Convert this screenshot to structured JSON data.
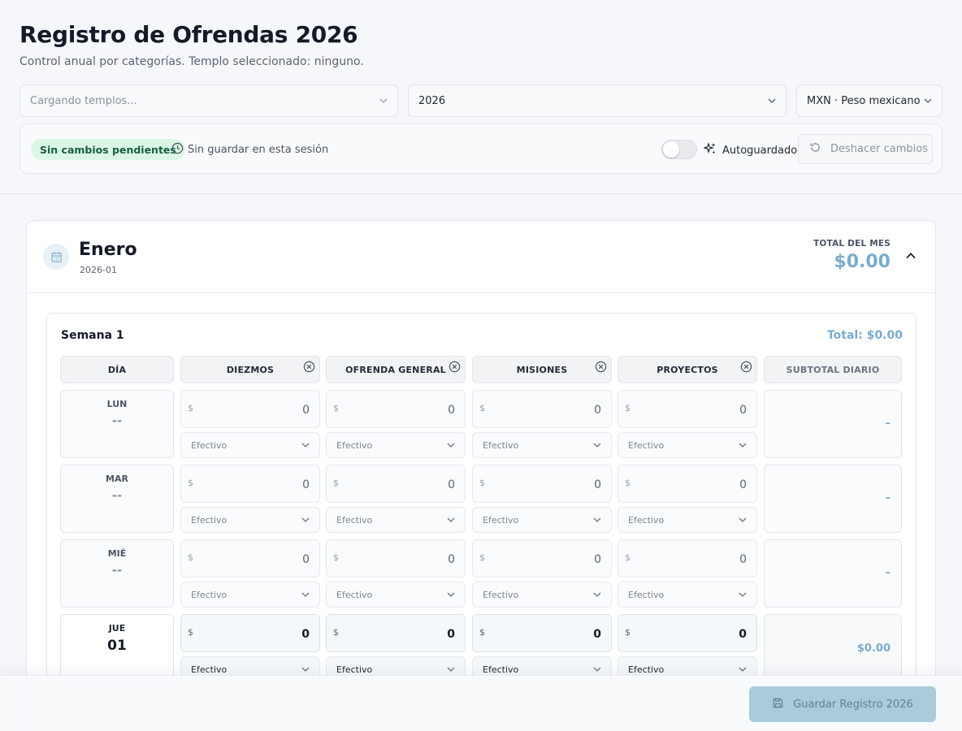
{
  "header": {
    "title": "Registro de Ofrendas 2026",
    "subtitle": "Control anual por categorías. Templo seleccionado: ninguno."
  },
  "filters": {
    "temple_placeholder": "Cargando templos...",
    "year": "2026",
    "currency": "MXN · Peso mexicano"
  },
  "status": {
    "badge": "Sin cambios pendientes",
    "session": "Sin guardar en esta sesión",
    "autosave_label": "Autoguardado",
    "autosave_on": false,
    "undo_label": "Deshacer cambios"
  },
  "month": {
    "name": "Enero",
    "code": "2026-01",
    "total_label": "TOTAL DEL MES",
    "total_value": "$0.00"
  },
  "week": {
    "title": "Semana 1",
    "total": "Total: $0.00",
    "columns": {
      "day": "DÍA",
      "categories": [
        "DIEZMOS",
        "OFRENDA GENERAL",
        "MISIONES",
        "PROYECTOS"
      ],
      "subtotal": "SUBTOTAL DIARIO"
    },
    "currency_symbol": "$",
    "rows": [
      {
        "day": "LUN",
        "date": "--",
        "active": false,
        "amounts": [
          "0",
          "0",
          "0",
          "0"
        ],
        "methods": [
          "Efectivo",
          "Efectivo",
          "Efectivo",
          "Efectivo"
        ],
        "subtotal": "–"
      },
      {
        "day": "MAR",
        "date": "--",
        "active": false,
        "amounts": [
          "0",
          "0",
          "0",
          "0"
        ],
        "methods": [
          "Efectivo",
          "Efectivo",
          "Efectivo",
          "Efectivo"
        ],
        "subtotal": "–"
      },
      {
        "day": "MIÉ",
        "date": "--",
        "active": false,
        "amounts": [
          "0",
          "0",
          "0",
          "0"
        ],
        "methods": [
          "Efectivo",
          "Efectivo",
          "Efectivo",
          "Efectivo"
        ],
        "subtotal": "–"
      },
      {
        "day": "JUE",
        "date": "01",
        "active": true,
        "amounts": [
          "0",
          "0",
          "0",
          "0"
        ],
        "methods": [
          "Efectivo",
          "Efectivo",
          "Efectivo",
          "Efectivo"
        ],
        "subtotal": "$0.00"
      }
    ]
  },
  "footer": {
    "save_label": "Guardar Registro 2026"
  }
}
